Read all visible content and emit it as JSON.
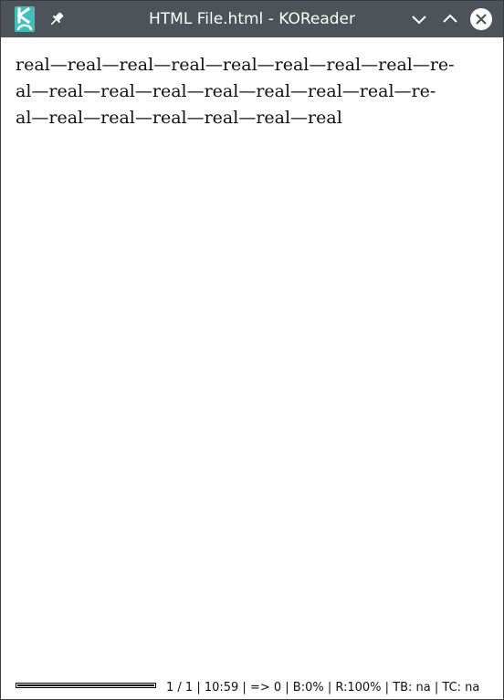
{
  "window": {
    "title": "HTML File.html - KOReader",
    "icons": {
      "app": "koreader-logo-icon",
      "pin": "pin-icon",
      "minimize": "chevron-down-icon",
      "maximize": "chevron-up-icon",
      "close": "close-icon"
    },
    "colors": {
      "titlebar": "#4d5359",
      "app_icon_accent": "#3cc0b8"
    }
  },
  "document": {
    "lines": [
      "real—real—real—real—real—real—real—real—re-",
      "al—real—real—real—real—real—real—real—re-",
      "al—real—real—real—real—real—real"
    ]
  },
  "footer": {
    "status": "1 / 1 | 10:59 | => 0 | B:0% | R:100% | TB: na | TC: na",
    "progress_fraction": 1.0
  }
}
